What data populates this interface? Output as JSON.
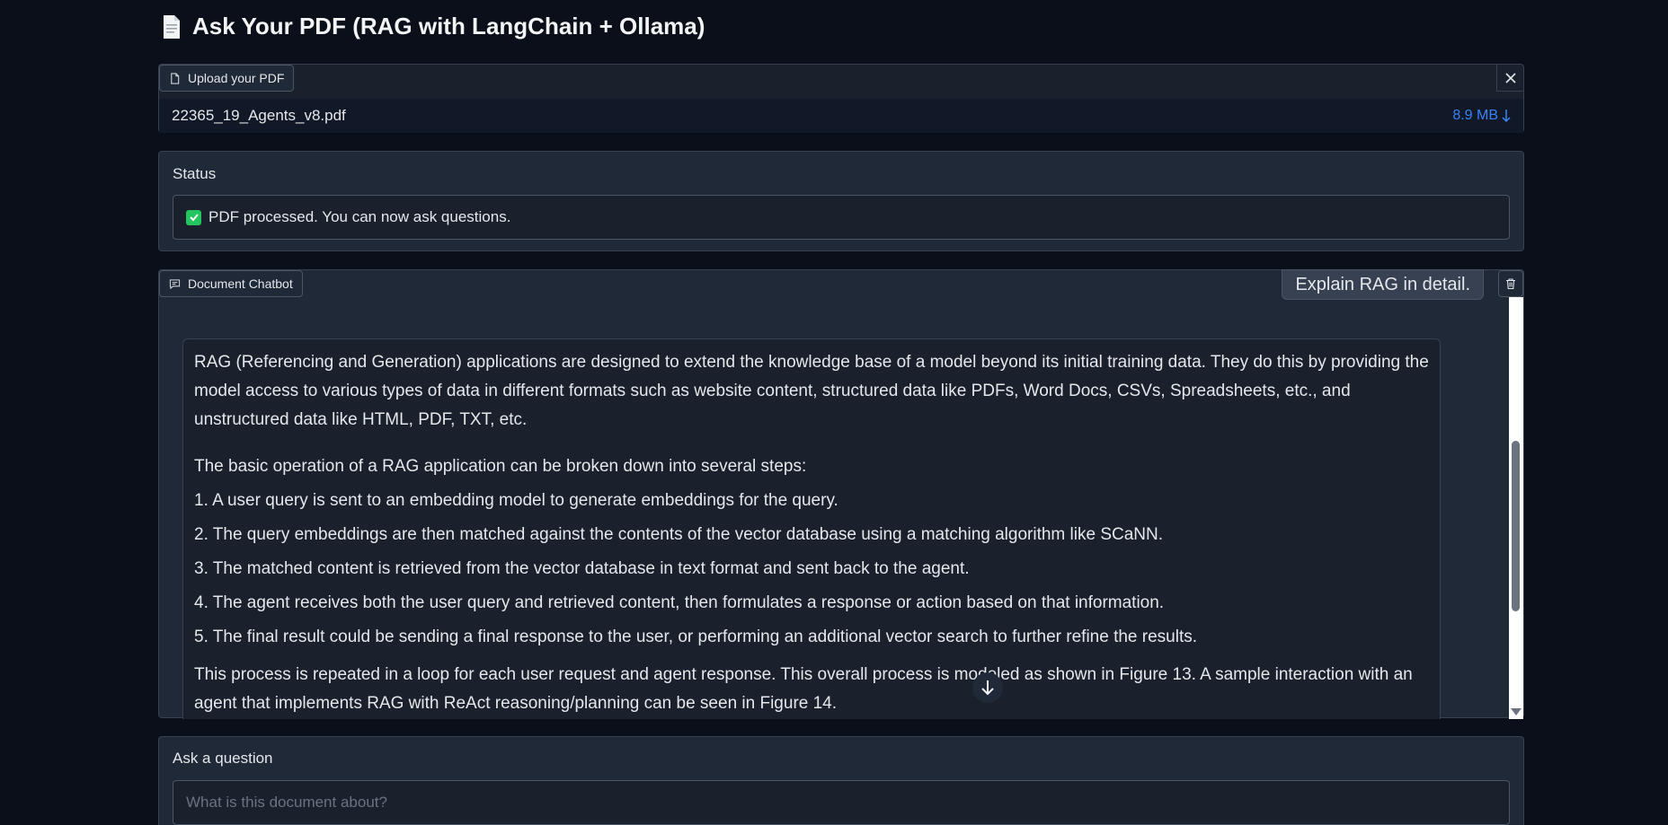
{
  "app": {
    "title": "Ask Your PDF (RAG with LangChain + Ollama)"
  },
  "upload": {
    "label": "Upload your PDF",
    "file_name": "22365_19_Agents_v8.pdf",
    "file_size": "8.9 MB"
  },
  "status": {
    "label": "Status",
    "message": "PDF processed. You can now ask questions."
  },
  "chatbot": {
    "label": "Document Chatbot",
    "user_message": "Explain RAG in detail.",
    "bot_paragraph_1": "RAG (Referencing and Generation) applications are designed to extend the knowledge base of a model beyond its initial training data. They do this by providing the model access to various types of data in different formats such as website content, structured data like PDFs, Word Docs, CSVs, Spreadsheets, etc., and unstructured data like HTML, PDF, TXT, etc.",
    "bot_paragraph_2": "The basic operation of a RAG application can be broken down into several steps:",
    "bot_steps": [
      "1. A user query is sent to an embedding model to generate embeddings for the query.",
      "2. The query embeddings are then matched against the contents of the vector database using a matching algorithm like SCaNN.",
      "3. The matched content is retrieved from the vector database in text format and sent back to the agent.",
      "4. The agent receives both the user query and retrieved content, then formulates a response or action based on that information.",
      "5. The final result could be sending a final response to the user, or performing an additional vector search to further refine the results."
    ],
    "bot_paragraph_3": "This process is repeated in a loop for each user request and agent response. This overall process is modeled as shown in Figure 13. A sample interaction with an agent that implements RAG with ReAct reasoning/planning can be seen in Figure 14."
  },
  "ask": {
    "label": "Ask a question",
    "placeholder": "What is this document about?"
  },
  "colors": {
    "background": "#0b0f19",
    "panel": "#1f2937",
    "accent": "#3b82f6",
    "success": "#22c55e"
  }
}
